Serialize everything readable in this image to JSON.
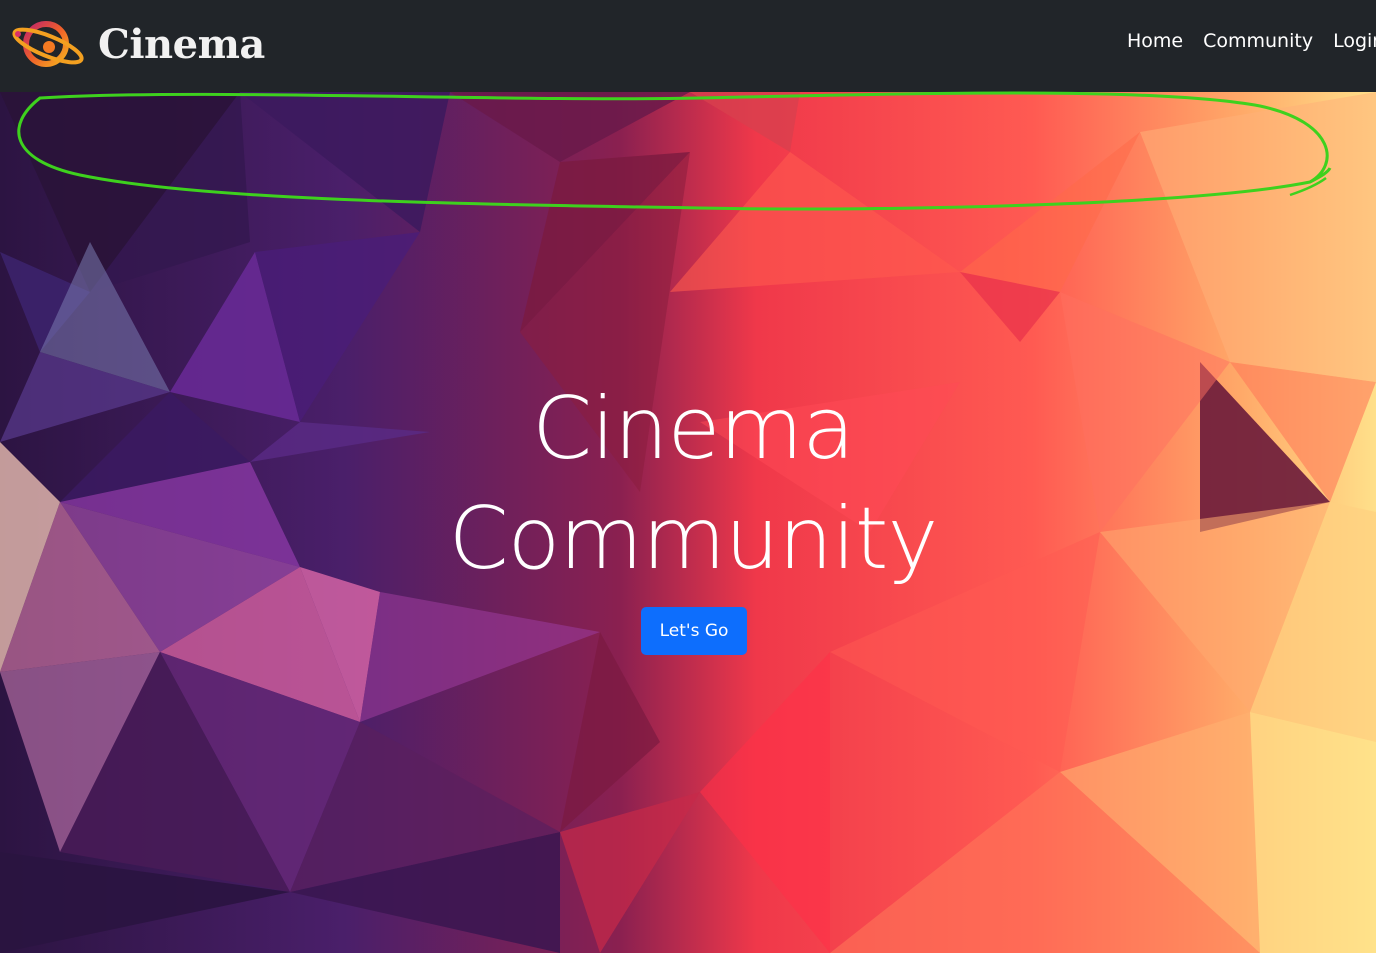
{
  "brand": {
    "name": "Cinema",
    "logo_icon": "orbit-planet-logo"
  },
  "nav": {
    "items": [
      {
        "label": "Home"
      },
      {
        "label": "Community"
      },
      {
        "label": "Login"
      }
    ]
  },
  "hero": {
    "title_line1": "Cinema",
    "title_line2": "Community",
    "cta_label": "Let's Go",
    "background": "low-poly-gradient"
  },
  "colors": {
    "navbar": "#212529",
    "cta": "#0d6efd",
    "annotation": "#3ed11e",
    "bg_purple": "#3a1550",
    "bg_red": "#ff3a4a",
    "bg_yellow": "#ffd878"
  },
  "annotation": {
    "type": "freehand-ellipse",
    "color": "#3ed11e"
  }
}
